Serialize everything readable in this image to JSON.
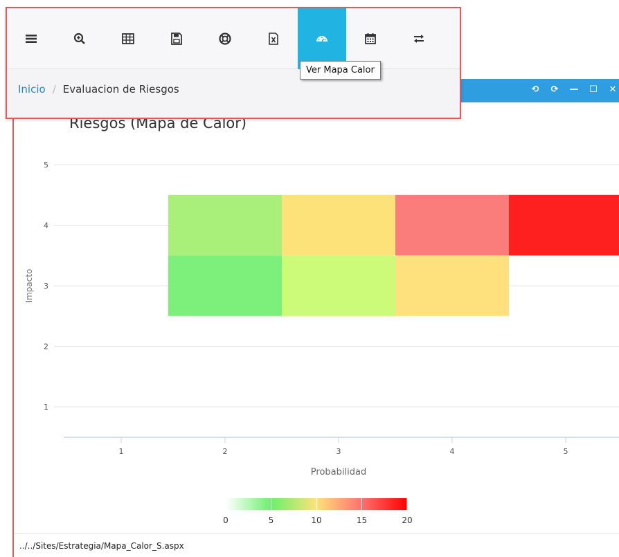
{
  "window": {
    "controls": [
      "⟲",
      "⟳",
      "—",
      "☐",
      "✕"
    ]
  },
  "toolbar": {
    "buttons": [
      {
        "name": "menu-icon"
      },
      {
        "name": "zoom-search-icon"
      },
      {
        "name": "table-icon"
      },
      {
        "name": "save-icon"
      },
      {
        "name": "lifebuoy-icon"
      },
      {
        "name": "excel-icon"
      },
      {
        "name": "dashboard-gauge-icon",
        "active": true
      },
      {
        "name": "calendar-icon"
      },
      {
        "name": "swap-arrows-icon"
      }
    ],
    "tooltip": "Ver Mapa Calor"
  },
  "breadcrumb": {
    "home": "Inicio",
    "separator": "/",
    "current": "Evaluacion de Riesgos"
  },
  "status": {
    "url": "../../Sites/Estrategia/Mapa_Calor_S.aspx"
  },
  "chart_data": {
    "type": "heatmap",
    "title": "Riesgos (Mapa de Calor)",
    "xlabel": "Probabilidad",
    "ylabel": "Impacto",
    "x_ticks": [
      1,
      2,
      3,
      4,
      5
    ],
    "y_ticks": [
      1,
      2,
      3,
      4,
      5
    ],
    "cells": [
      {
        "x": 2,
        "y": 4,
        "color": "#a9f07a"
      },
      {
        "x": 3,
        "y": 4,
        "color": "#fde27a"
      },
      {
        "x": 4,
        "y": 4,
        "color": "#fb7d7b"
      },
      {
        "x": 5,
        "y": 4,
        "color": "#fe1f1f"
      },
      {
        "x": 2,
        "y": 3,
        "color": "#7df07c"
      },
      {
        "x": 3,
        "y": 3,
        "color": "#ccfb7a"
      },
      {
        "x": 4,
        "y": 3,
        "color": "#fee07d"
      }
    ],
    "color_scale": {
      "min": 0,
      "max": 20,
      "ticks": [
        0,
        5,
        10,
        15,
        20
      ],
      "stops": [
        "#ffffff",
        "#6cf06c",
        "#fde27a",
        "#ff7070",
        "#ff0000"
      ]
    }
  }
}
